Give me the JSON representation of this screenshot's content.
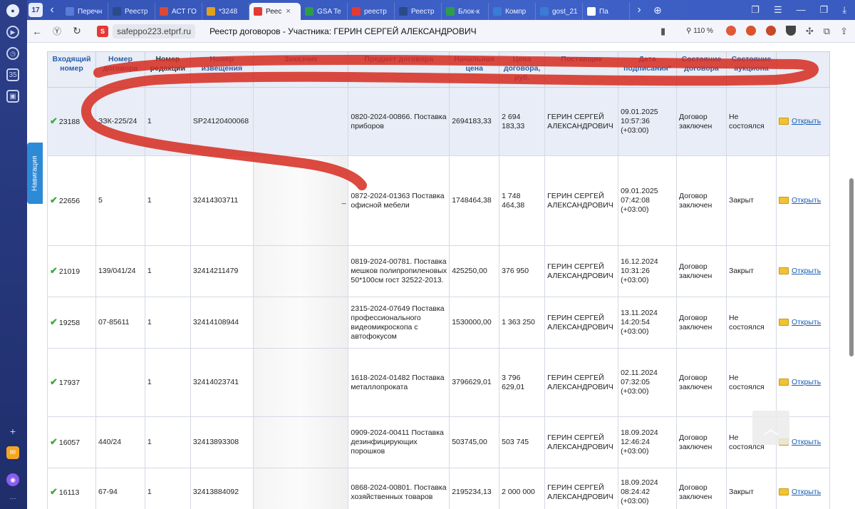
{
  "browser": {
    "tab_count": "17",
    "tabs": [
      {
        "label": "Перечн",
        "color": "#5b7bd8"
      },
      {
        "label": "Реестр",
        "color": "#2b4a8a"
      },
      {
        "label": "АСТ ГО",
        "color": "#d84a3a"
      },
      {
        "label": "*3248",
        "color": "#e0a020"
      },
      {
        "label": "Реес",
        "color": "#e53935",
        "active": true
      },
      {
        "label": "GSA Te",
        "color": "#2e9d4a"
      },
      {
        "label": "реестр",
        "color": "#e53935"
      },
      {
        "label": "Реестр",
        "color": "#2b4a8a"
      },
      {
        "label": "Блок-к",
        "color": "#2e9d4a"
      },
      {
        "label": "Компр",
        "color": "#3a7bd5"
      },
      {
        "label": "gost_21",
        "color": "#3a7bd5"
      },
      {
        "label": "Па",
        "color": "#ffffff"
      }
    ],
    "url_domain": "safeppo223.etprf.ru",
    "page_title": "Реестр договоров - Участника: ГЕРИН СЕРГЕЙ АЛЕКСАНДРОВИЧ",
    "zoom": "110 %",
    "sidebar_badge": "35"
  },
  "side_nav_label": "Навигация",
  "table": {
    "headers": [
      "Входящий номер",
      "Номер договора",
      "Номер редакции",
      "Номер извещения",
      "Заказчик",
      "Предмет договора",
      "Начальная цена",
      "Цена договора, руб.",
      "Поставщик",
      "Дата подписания*",
      "Состояние договора",
      "Состояние аукциона",
      ""
    ],
    "rows": [
      {
        "in": "23188",
        "contract": "ЗЗК-225/24",
        "rev": "1",
        "notice": "SP24120400068",
        "customer": "",
        "subject": "0820-2024-00866. Поставка приборов",
        "start": "2694183,33",
        "price": "2 694 183,33",
        "supplier": "ГЕРИН СЕРГЕЙ АЛЕКСАНДРОВИЧ",
        "date": "09.01.2025 10:57:36 (+03:00)",
        "state": "Договор заключен",
        "auction": "Не состоялся",
        "open": "Открыть"
      },
      {
        "in": "22656",
        "contract": "5",
        "rev": "1",
        "notice": "32414303711",
        "customer": "_",
        "subject": "0872-2024-01363 Поставка офисной мебели",
        "start": "1748464,38",
        "price": "1 748 464,38",
        "supplier": "ГЕРИН СЕРГЕЙ АЛЕКСАНДРОВИЧ",
        "date": "09.01.2025 07:42:08 (+03:00)",
        "state": "Договор заключен",
        "auction": "Закрыт",
        "open": "Открыть"
      },
      {
        "in": "21019",
        "contract": "139/041/24",
        "rev": "1",
        "notice": "32414211479",
        "customer": "",
        "subject": "0819-2024-00781. Поставка мешков полипропиленовых 50*100см гост 32522-2013.",
        "start": "425250,00",
        "price": "376 950",
        "supplier": "ГЕРИН СЕРГЕЙ АЛЕКСАНДРОВИЧ",
        "date": "16.12.2024 10:31:26 (+03:00)",
        "state": "Договор заключен",
        "auction": "Закрыт",
        "open": "Открыть"
      },
      {
        "in": "19258",
        "contract": "07-85611",
        "rev": "1",
        "notice": "32414108944",
        "customer": "",
        "subject": "2315-2024-07649 Поставка профессионального видеомикроскопа с автофокусом",
        "start": "1530000,00",
        "price": "1 363 250",
        "supplier": "ГЕРИН СЕРГЕЙ АЛЕКСАНДРОВИЧ",
        "date": "13.11.2024 14:20:54 (+03:00)",
        "state": "Договор заключен",
        "auction": "Не состоялся",
        "open": "Открыть"
      },
      {
        "in": "17937",
        "contract": "",
        "rev": "1",
        "notice": "32414023741",
        "customer": "",
        "subject": "1618-2024-01482 Поставка металлопроката",
        "start": "3796629,01",
        "price": "3 796 629,01",
        "supplier": "ГЕРИН СЕРГЕЙ АЛЕКСАНДРОВИЧ",
        "date": "02.11.2024 07:32:05 (+03:00)",
        "state": "Договор заключен",
        "auction": "Не состоялся",
        "open": "Открыть"
      },
      {
        "in": "16057",
        "contract": "440/24",
        "rev": "1",
        "notice": "32413893308",
        "customer": "",
        "subject": "0909-2024-00411 Поставка дезинфицирующих порошков",
        "start": "503745,00",
        "price": "503 745",
        "supplier": "ГЕРИН СЕРГЕЙ АЛЕКСАНДРОВИЧ",
        "date": "18.09.2024 12:46:24 (+03:00)",
        "state": "Договор заключен",
        "auction": "Не состоялся",
        "open": "Открыть"
      },
      {
        "in": "16113",
        "contract": "67-94",
        "rev": "1",
        "notice": "32413884092",
        "customer": "",
        "subject": "0868-2024-00801. Поставка хозяйственных товаров",
        "start": "2195234,13",
        "price": "2 000 000",
        "supplier": "ГЕРИН СЕРГЕЙ АЛЕКСАНДРОВИЧ",
        "date": "18.09.2024 08:24:42 (+03:00)",
        "state": "Договор заключен",
        "auction": "Закрыт",
        "open": "Открыть"
      }
    ]
  }
}
